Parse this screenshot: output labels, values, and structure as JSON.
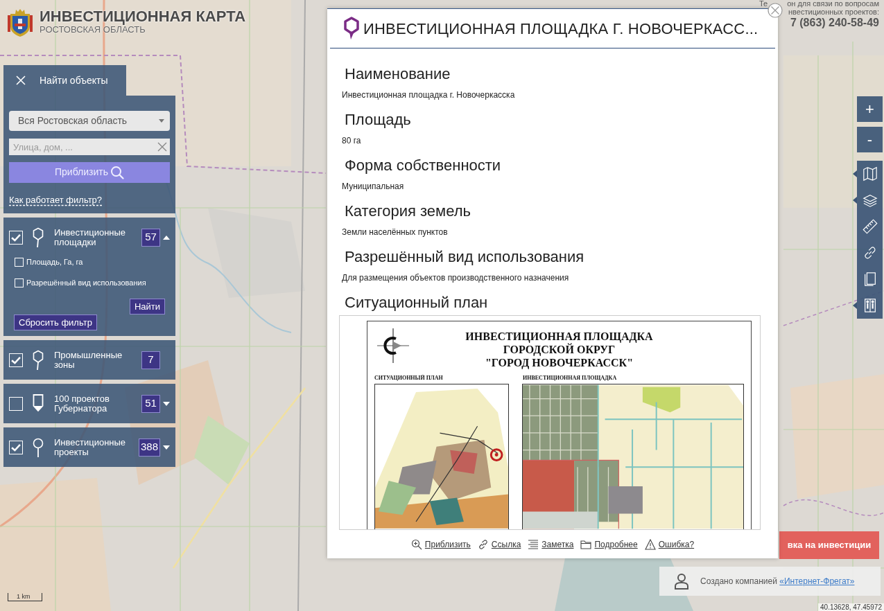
{
  "header": {
    "title": "ИНВЕСТИЦИОННАЯ КАРТА",
    "subtitle": "РОСТОВСКАЯ ОБЛАСТЬ"
  },
  "contact": {
    "line_1_parts": [
      "Те",
      "он для связи по вопросам"
    ],
    "line_2": "нвестиционных проектов:",
    "phone": "7 (863) 240-58-49"
  },
  "search_panel": {
    "title": "Найти объекты",
    "region": "Вся Ростовская область",
    "address": {
      "placeholder": "Улица, дом, ..."
    },
    "zoom_button": "Приблизить",
    "help_link": "Как работает фильтр?"
  },
  "layers": [
    {
      "label": "Инвестиционные площадки",
      "checked": true,
      "count": "57",
      "expanded": true,
      "filters": [
        {
          "label": "Площадь, Га, га",
          "checked": false
        },
        {
          "label": "Разрешённый вид использования",
          "checked": false
        }
      ],
      "find_button": "Найти",
      "reset_button": "Сбросить фильтр"
    },
    {
      "label": "Промышленные зоны",
      "checked": true,
      "count": "7"
    },
    {
      "label": "100 проектов Губернатора",
      "checked": false,
      "count": "51",
      "expanded": false
    },
    {
      "label": "Инвестиционные проекты",
      "checked": true,
      "count": "388",
      "expanded": false
    }
  ],
  "map_controls": {
    "zoom_in": "+",
    "zoom_out": "-",
    "tools": [
      {
        "submenu": true
      },
      {
        "submenu": true
      },
      {
        "submenu": false
      },
      {
        "submenu": false
      },
      {
        "submenu": false
      },
      {
        "submenu": true
      }
    ]
  },
  "details": {
    "title": "ИНВЕСТИЦИОННАЯ ПЛОЩАДКА Г. НОВОЧЕРКАСС...",
    "fields": [
      {
        "heading": "Наименование",
        "value": "Инвестиционная площадка г. Новочеркасска"
      },
      {
        "heading": "Площадь",
        "value": "80 га"
      },
      {
        "heading": "Форма собственности",
        "value": "Муниципальная"
      },
      {
        "heading": "Категория земель",
        "value": "Земли населённых пунктов"
      },
      {
        "heading": "Разрешённый вид использования",
        "value": "Для размещения объектов производственного назначения"
      }
    ],
    "plan": {
      "heading": "Ситуационный план",
      "title_lines": [
        "ИНВЕСТИЦИОННАЯ ПЛОЩАДКА",
        "ГОРОДСКОЙ ОКРУГ",
        "\"ГОРОД НОВОЧЕРКАССК\""
      ],
      "left_caption": "СИТУАЦИОННЫЙ ПЛАН",
      "right_caption": "ИНВЕСТИЦИОННАЯ ПЛОЩАДКА"
    },
    "actions": [
      "Приблизить",
      "Ссылка",
      "Заметка",
      "Подробнее",
      "Ошибка?"
    ]
  },
  "application_button": "вка на инвестиции",
  "credit": {
    "text": "Создано компанией",
    "link": "«Интернет-Фрегат»"
  },
  "map": {
    "scale": "1 km",
    "coordinates": "40.13628, 47.45972"
  }
}
